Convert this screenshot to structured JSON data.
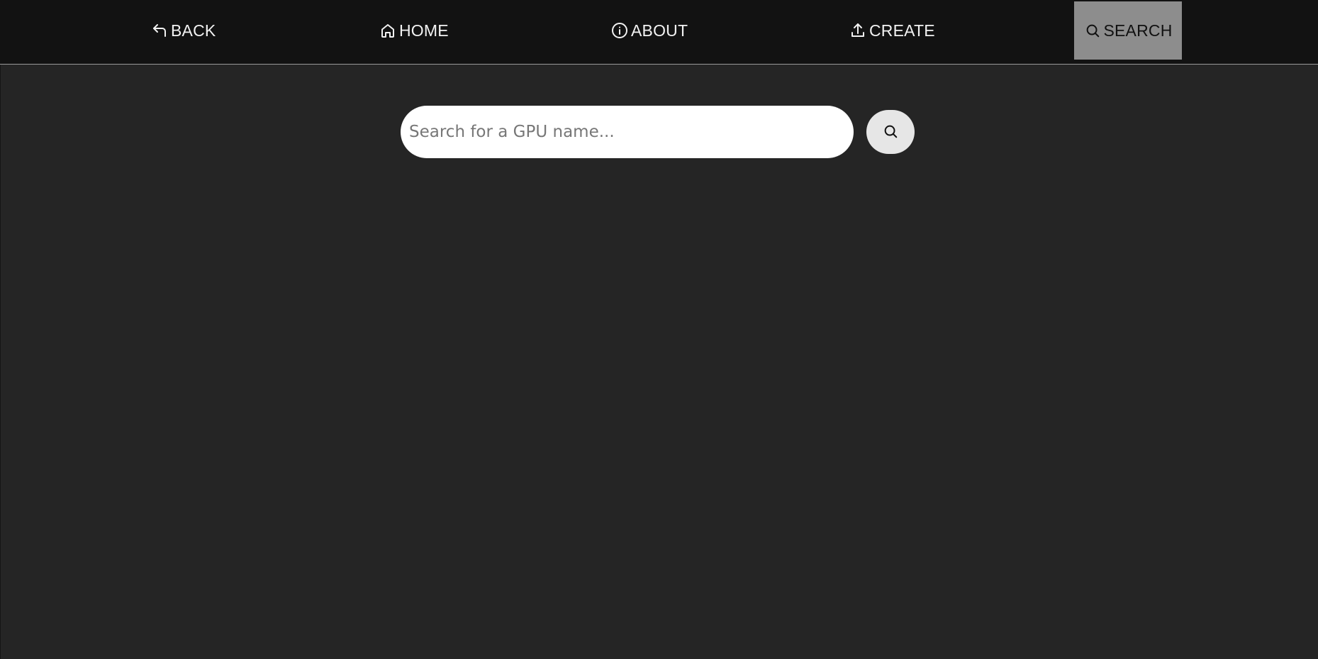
{
  "nav": {
    "back": {
      "label": "BACK",
      "icon": "undo-arrow-icon"
    },
    "home": {
      "label": "HOME",
      "icon": "home-icon"
    },
    "about": {
      "label": "ABOUT",
      "icon": "info-circle-icon"
    },
    "create": {
      "label": "CREATE",
      "icon": "upload-icon"
    },
    "search": {
      "label": "SEARCH",
      "icon": "search-icon",
      "active": true
    }
  },
  "search": {
    "placeholder": "Search for a GPU name...",
    "value": "",
    "button_icon": "search-icon"
  },
  "colors": {
    "navbar_bg": "#121212",
    "page_bg": "#252525",
    "active_tab_bg": "#8d8d8d",
    "input_bg": "#ffffff",
    "search_button_bg": "#e6e6e6"
  }
}
